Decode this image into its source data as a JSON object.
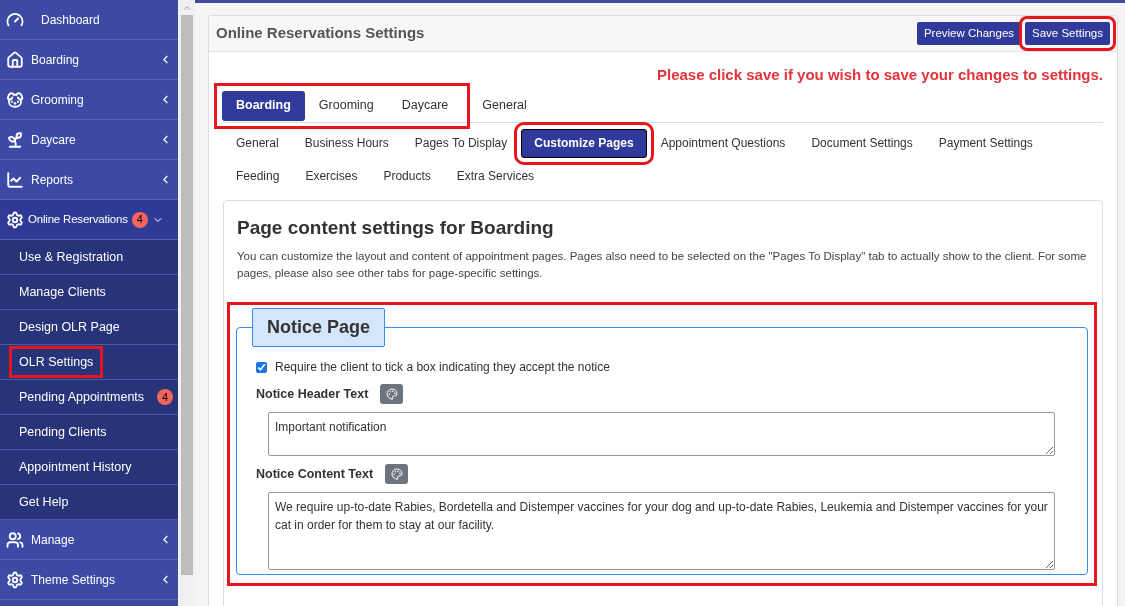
{
  "sidebar": {
    "items": [
      {
        "label": "Dashboard",
        "kind": "link"
      },
      {
        "label": "Boarding",
        "kind": "menu",
        "expanded": false
      },
      {
        "label": "Grooming",
        "kind": "menu",
        "expanded": false
      },
      {
        "label": "Daycare",
        "kind": "menu",
        "expanded": false
      },
      {
        "label": "Reports",
        "kind": "menu",
        "expanded": false
      },
      {
        "label": "Online Reservations",
        "kind": "menu",
        "expanded": true,
        "badge": "4",
        "children": [
          {
            "label": "Use & Registration",
            "highlighted": false
          },
          {
            "label": "Manage Clients",
            "highlighted": false
          },
          {
            "label": "Design OLR Page",
            "highlighted": false
          },
          {
            "label": "OLR Settings",
            "highlighted": true
          },
          {
            "label": "Pending Appointments",
            "highlighted": false,
            "badge": "4"
          },
          {
            "label": "Pending Clients",
            "highlighted": false
          },
          {
            "label": "Appointment History",
            "highlighted": false
          },
          {
            "label": "Get Help",
            "highlighted": false
          }
        ]
      },
      {
        "label": "Manage",
        "kind": "menu",
        "expanded": false
      },
      {
        "label": "Theme Settings",
        "kind": "menu",
        "expanded": false
      }
    ]
  },
  "panel": {
    "title": "Online Reservations Settings",
    "buttons": [
      {
        "label": "Preview Changes",
        "highlighted": false
      },
      {
        "label": "Save Settings",
        "highlighted": true
      }
    ],
    "warning": "Please click save if you wish to save your changes to settings.",
    "service_tabs_highlighted": true,
    "service_tabs": [
      {
        "label": "Boarding",
        "selected": true
      },
      {
        "label": "Grooming",
        "selected": false
      },
      {
        "label": "Daycare",
        "selected": false
      },
      {
        "label": "General",
        "selected": false
      }
    ],
    "setting_tabs": [
      {
        "label": "General",
        "selected": false,
        "highlighted": false
      },
      {
        "label": "Business Hours",
        "selected": false,
        "highlighted": false
      },
      {
        "label": "Pages To Display",
        "selected": false,
        "highlighted": false
      },
      {
        "label": "Customize Pages",
        "selected": true,
        "highlighted": true
      },
      {
        "label": "Appointment Questions",
        "selected": false,
        "highlighted": false
      },
      {
        "label": "Document Settings",
        "selected": false,
        "highlighted": false
      },
      {
        "label": "Payment Settings",
        "selected": false,
        "highlighted": false
      },
      {
        "label": "Feeding",
        "selected": false,
        "highlighted": false
      },
      {
        "label": "Exercises",
        "selected": false,
        "highlighted": false
      },
      {
        "label": "Products",
        "selected": false,
        "highlighted": false
      },
      {
        "label": "Extra Services",
        "selected": false,
        "highlighted": false
      }
    ],
    "card": {
      "heading": "Page content settings for Boarding",
      "description": "You can customize the layout and content of appointment pages. Pages also need to be selected on the \"Pages To Display\" tab to actually show to the client. For some pages, please also see other tabs for page-specific settings.",
      "section": {
        "title": "Notice Page",
        "highlighted": true,
        "checkbox": {
          "label": "Require the client to tick a box indicating they accept the notice",
          "checked": true
        },
        "fields": [
          {
            "label": "Notice Header Text",
            "value": "Important notification"
          },
          {
            "label": "Notice Content Text",
            "value": "We require up-to-date Rabies, Bordetella and Distemper vaccines for your dog and up-to-date Rabies, Leukemia and Distemper vaccines for your cat in order for them to stay at our facility."
          }
        ]
      }
    }
  }
}
